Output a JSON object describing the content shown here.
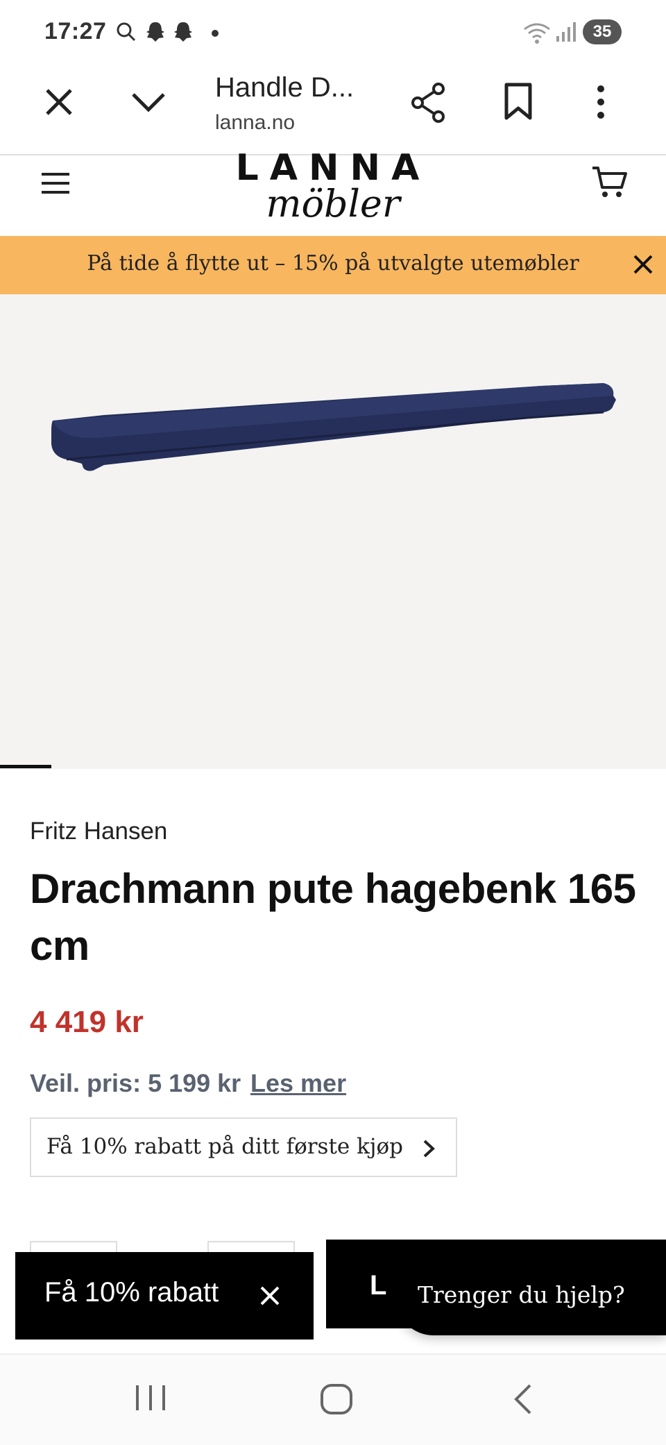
{
  "status_bar": {
    "time": "17:27",
    "battery": "35",
    "icons": [
      "search-icon",
      "snapchat-icon",
      "snapchat-icon",
      "dot-icon",
      "wifi-icon",
      "signal-icon"
    ]
  },
  "browser": {
    "title": "Handle D...",
    "domain": "lanna.no"
  },
  "site": {
    "logo_line1": "LANNA",
    "logo_line2": "möbler"
  },
  "promo": {
    "text": "På tide å flytte ut – 15% på utvalgte utemøbler"
  },
  "product": {
    "brand": "Fritz Hansen",
    "title": "Drachmann pute hagebenk 165 cm",
    "price": "4 419 kr",
    "rrp": "Veil. pris: 5 199 kr",
    "read_more": "Les mer",
    "discount_offer": "Få 10% rabatt på ditt første kjøp",
    "image_color": "#262f59"
  },
  "popups": {
    "discount_label": "Få 10% rabatt",
    "panel_partial_text": "L",
    "help_label": "Trenger du hjelp?"
  },
  "colors": {
    "promo_bg": "#f8b65f",
    "price": "#c0332b",
    "muted": "#5a6270"
  }
}
